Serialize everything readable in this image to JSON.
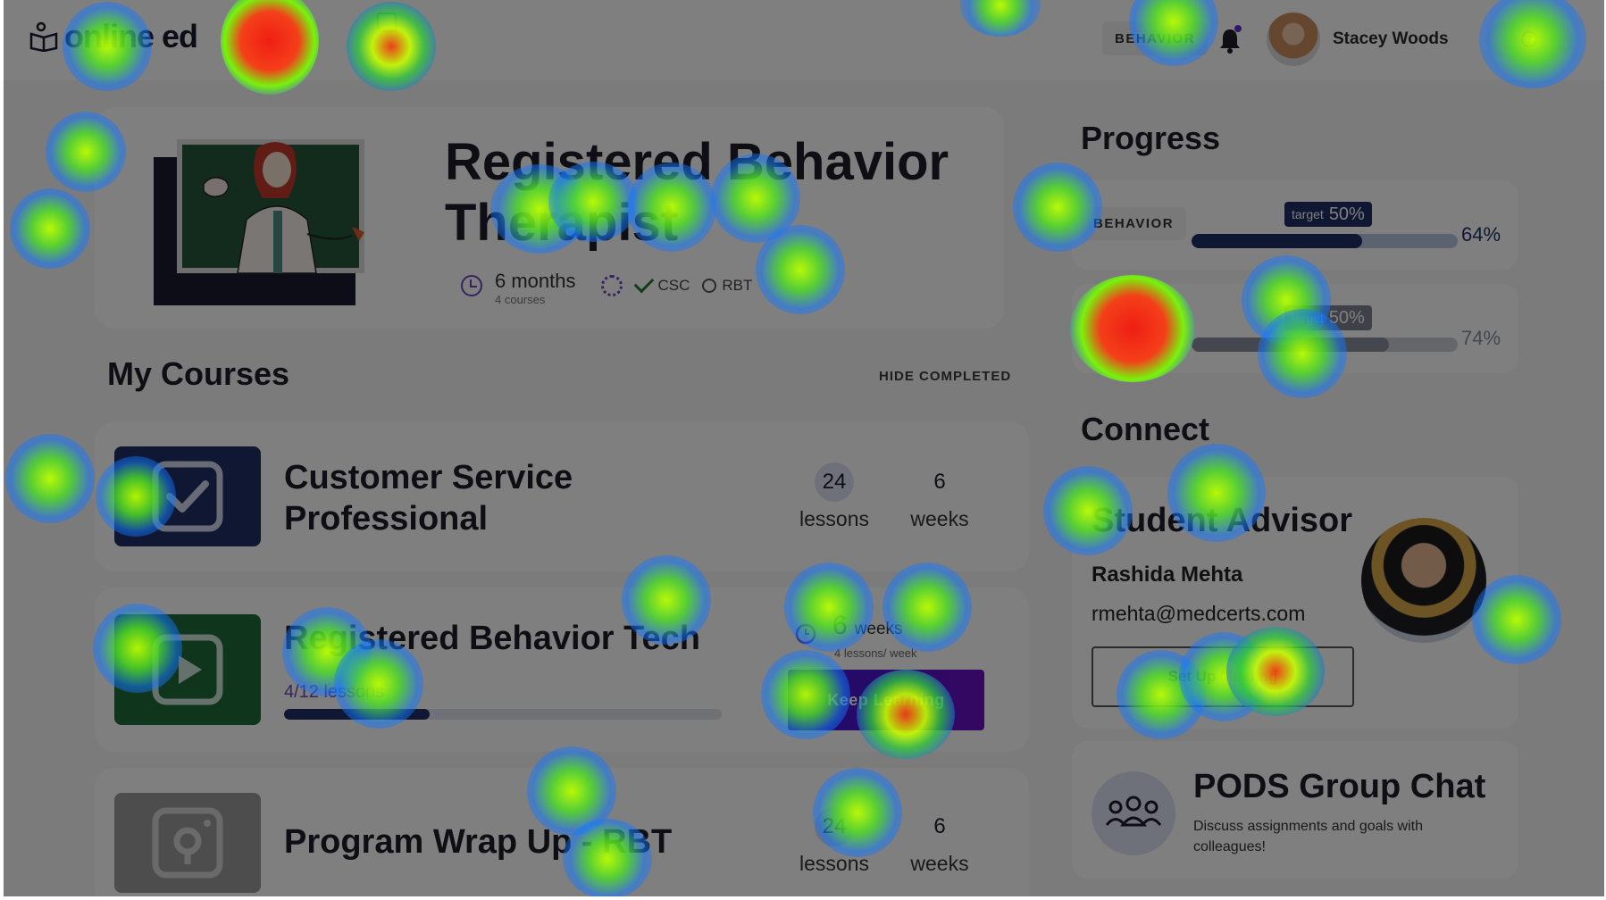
{
  "header": {
    "logo_text": "online ed",
    "behavior_chip": "BEHAVIOR",
    "user_name": "Stacey Woods"
  },
  "hero": {
    "title": "Registered Behavior Therapist",
    "duration": "6 months",
    "duration_sub": "4 courses",
    "credentials": [
      {
        "label": "CSC",
        "done": true
      },
      {
        "label": "RBT",
        "done": false
      }
    ]
  },
  "courses_section": {
    "title": "My Courses",
    "hide_completed_label": "HIDE COMPLETED"
  },
  "courses": [
    {
      "name_line1": "Customer Service",
      "name_line2": "Professional",
      "lessons": "24",
      "lessons_label": "lessons",
      "weeks": "6",
      "weeks_label": "weeks",
      "thumb_color": "#1e2f66",
      "icon": "checkbox-icon"
    },
    {
      "name": "Registered Behavior Tech",
      "progress_label": "4/12 lessons",
      "progress_fraction": 0.333,
      "weeks": "6",
      "weeks_label": "weeks",
      "weeks_sub": "4 lessons/ week",
      "button_label": "Keep Learning",
      "thumb_color": "#1f6b3a",
      "icon": "video-icon"
    },
    {
      "name": "Program Wrap Up - RBT",
      "lessons": "24",
      "lessons_label": "lessons",
      "weeks": "6",
      "weeks_label": "weeks",
      "thumb_color": "#9a9a9a",
      "icon": "camera-icon"
    }
  ],
  "progress_section": {
    "title": "Progress",
    "items": [
      {
        "label": "BEHAVIOR",
        "target_label": "target",
        "target": "50%",
        "target_fraction": 0.5,
        "value": "64%",
        "fraction": 0.64
      },
      {
        "label": "",
        "target_label": "target",
        "target": "50%",
        "target_fraction": 0.5,
        "value": "74%",
        "fraction": 0.74
      }
    ]
  },
  "connect_section": {
    "title": "Connect",
    "advisor_title": "Student Advisor",
    "advisor_name": "Rashida Mehta",
    "advisor_email": "rmehta@medcerts.com",
    "meeting_button": "Set Up Meeting"
  },
  "pods": {
    "title": "PODS Group Chat",
    "description": "Discuss assignments and goals with colleagues!"
  },
  "colors": {
    "brand_dark": "#1e2f66",
    "accent_purple": "#6b46c1",
    "button_gradient_start": "#3a16d8",
    "button_gradient_end": "#6a10c4"
  }
}
